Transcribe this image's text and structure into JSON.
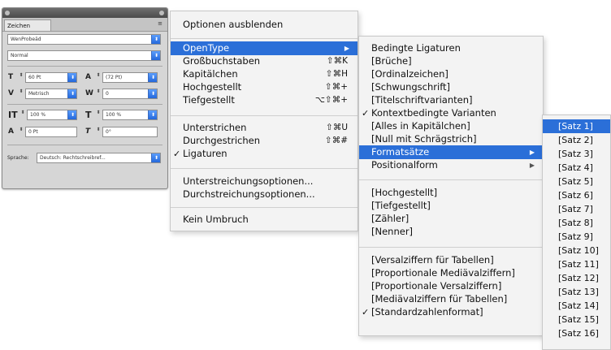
{
  "panel": {
    "tab_label": "Zeichen",
    "font_family": "WenProbeäd",
    "font_style": "Normal",
    "size": "60 Pt",
    "leading": "(72 Pt)",
    "kerning": "Metrisch",
    "tracking": "0",
    "vertical_scale": "100 %",
    "horizontal_scale": "100 %",
    "baseline_shift": "0 Pt",
    "skew": "0°",
    "language_label": "Sprache:",
    "language_value": "Deutsch: Rechtschreibref..."
  },
  "menu1": {
    "header": "Optionen ausblenden",
    "items": [
      {
        "label": "OpenType",
        "highlighted": true,
        "submenu": true
      },
      {
        "label": "Großbuchstaben",
        "shortcut": "⇧⌘K"
      },
      {
        "label": "Kapitälchen",
        "shortcut": "⇧⌘H"
      },
      {
        "label": "Hochgestellt",
        "shortcut": "⇧⌘+"
      },
      {
        "label": "Tiefgestellt",
        "shortcut": "⌥⇧⌘+"
      },
      {
        "label": "Unterstrichen",
        "shortcut": "⇧⌘U"
      },
      {
        "label": "Durchgestrichen",
        "shortcut": "⇧⌘#"
      },
      {
        "label": "Ligaturen",
        "checked": true
      },
      {
        "label": "Unterstreichungsoptionen..."
      },
      {
        "label": "Durchstreichungsoptionen..."
      },
      {
        "label": "Kein Umbruch"
      }
    ]
  },
  "menu2": {
    "items": [
      {
        "label": "Bedingte Ligaturen"
      },
      {
        "label": "[Brüche]"
      },
      {
        "label": "[Ordinalzeichen]"
      },
      {
        "label": "[Schwungschrift]"
      },
      {
        "label": "[Titelschriftvarianten]"
      },
      {
        "label": "Kontextbedingte Varianten",
        "checked": true
      },
      {
        "label": "[Alles in Kapitälchen]"
      },
      {
        "label": "[Null mit Schrägstrich]"
      },
      {
        "label": "Formatsätze",
        "highlighted": true,
        "submenu": true
      },
      {
        "label": "Positionalform",
        "submenu": true
      },
      {
        "label": "[Hochgestellt]"
      },
      {
        "label": "[Tiefgestellt]"
      },
      {
        "label": "[Zähler]"
      },
      {
        "label": "[Nenner]"
      },
      {
        "label": "[Versalziffern für Tabellen]"
      },
      {
        "label": "[Proportionale Mediävalziffern]"
      },
      {
        "label": "[Proportionale Versalziffern]"
      },
      {
        "label": "[Mediävalziffern für Tabellen]"
      },
      {
        "label": "[Standardzahlenformat]",
        "checked": true
      }
    ]
  },
  "menu3": {
    "items": [
      {
        "label": "[Satz 1]",
        "highlighted": true
      },
      {
        "label": "[Satz 2]"
      },
      {
        "label": "[Satz 3]"
      },
      {
        "label": "[Satz 4]"
      },
      {
        "label": "[Satz 5]"
      },
      {
        "label": "[Satz 6]"
      },
      {
        "label": "[Satz 7]"
      },
      {
        "label": "[Satz 8]"
      },
      {
        "label": "[Satz 9]"
      },
      {
        "label": "[Satz 10]"
      },
      {
        "label": "[Satz 11]"
      },
      {
        "label": "[Satz 12]"
      },
      {
        "label": "[Satz 13]"
      },
      {
        "label": "[Satz 14]"
      },
      {
        "label": "[Satz 15]"
      },
      {
        "label": "[Satz 16]"
      }
    ]
  },
  "glyphs": {
    "check": "✓",
    "submenu_arrow": "▶",
    "dropdown_arrow": "⬍",
    "stepper": "⬍",
    "panel_menu": "≡"
  },
  "colors": {
    "highlight": "#2b6fd8",
    "menu_bg": "#f3f3f3",
    "panel_bg": "#d6d6d6"
  }
}
